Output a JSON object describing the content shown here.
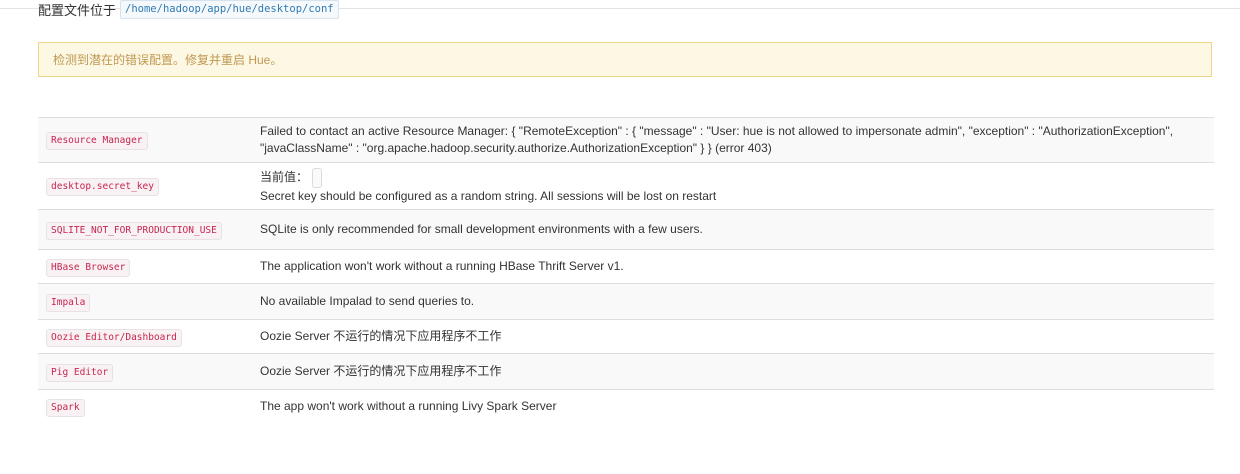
{
  "config": {
    "location_label": "配置文件位于",
    "location_path": "/home/hadoop/app/hue/desktop/conf"
  },
  "alert": {
    "message": "检测到潜在的错误配置。修复并重启 Hue。"
  },
  "checks": [
    {
      "name": "Resource Manager",
      "message": "Failed to contact an active Resource Manager: { \"RemoteException\" : { \"message\" : \"User: hue is not allowed to impersonate admin\", \"exception\" : \"AuthorizationException\", \"javaClassName\" : \"org.apache.hadoop.security.authorize.AuthorizationException\" } } (error 403)"
    },
    {
      "name": "desktop.secret_key",
      "current_value_label": "当前值：",
      "message": "Secret key should be configured as a random string. All sessions will be lost on restart"
    },
    {
      "name": "SQLITE_NOT_FOR_PRODUCTION_USE",
      "message": "SQLite is only recommended for small development environments with a few users."
    },
    {
      "name": "HBase Browser",
      "message": "The application won't work without a running HBase Thrift Server v1."
    },
    {
      "name": "Impala",
      "message": "No available Impalad to send queries to."
    },
    {
      "name": "Oozie Editor/Dashboard",
      "message": "Oozie Server 不运行的情况下应用程序不工作"
    },
    {
      "name": "Pig Editor",
      "message": "Oozie Server 不运行的情况下应用程序不工作"
    },
    {
      "name": "Spark",
      "message": "The app won't work without a running Livy Spark Server"
    }
  ],
  "colors": {
    "alert_background": "#fcf8e3",
    "alert_text": "#c09853",
    "code_text": "#c7254e",
    "path_text": "#2f7bb3",
    "row_stripe": "#f9f9f9"
  }
}
